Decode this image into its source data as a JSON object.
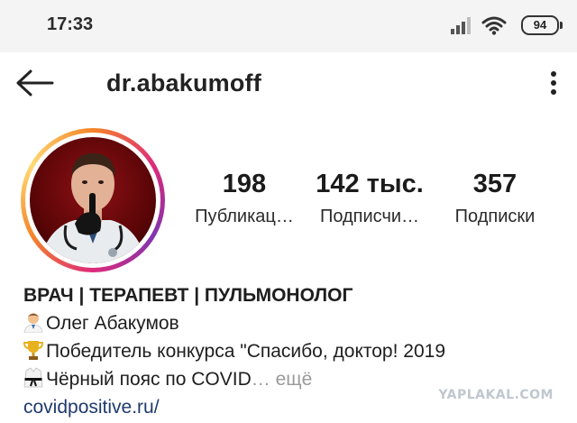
{
  "status_bar": {
    "time": "17:33",
    "battery": "94"
  },
  "header": {
    "username": "dr.abakumoff"
  },
  "stats": [
    {
      "value": "198",
      "label": "Публикац…"
    },
    {
      "value": "142 тыс.",
      "label": "Подписчи…"
    },
    {
      "value": "357",
      "label": "Подписки"
    }
  ],
  "bio": {
    "title": "ВРАЧ | ТЕРАПЕВТ | ПУЛЬМОНОЛОГ",
    "line1": "Олег Абакумов",
    "line2": "Победитель конкурса \"Спасибо, доктор! 2019",
    "line3": "Чёрный пояс по COVID",
    "ellipsis": "…",
    "more": "ещё",
    "link": "covidpositive.ru/"
  },
  "watermark": "YAPLAKAL.COM",
  "icons": {
    "line1": "doctor-emoji-icon",
    "line2": "trophy-emoji-icon",
    "line3": "martial-arts-uniform-emoji-icon"
  },
  "colors": {
    "link": "#1f3a6e",
    "muted": "#9a9a9a",
    "ring": [
      "#f58529",
      "#dd2a7b",
      "#8134af",
      "#feda75"
    ]
  }
}
